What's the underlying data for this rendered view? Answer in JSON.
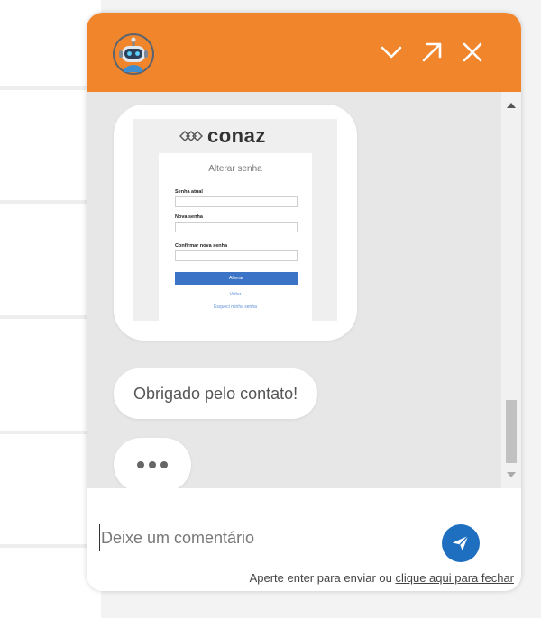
{
  "colors": {
    "header": "#f0852b",
    "send_button": "#1e6fc0",
    "chat_background": "#e7e7e7"
  },
  "header": {
    "avatar_icon": "robot-avatar-icon",
    "minimize_icon": "chevron-down-icon",
    "expand_icon": "arrow-up-right-icon",
    "close_icon": "close-icon"
  },
  "messages": {
    "image_preview": {
      "logo_text": "conaz",
      "form_title": "Alterar senha",
      "fields": [
        "Senha atual",
        "Nova senha",
        "Confirmar nova senha"
      ],
      "button_label": "Alterar",
      "link_back": "Voltar",
      "link_forgot": "Esqueci minha senha"
    },
    "text_message": "Obrigado pelo contato!",
    "typing_indicator": "typing-dots-icon"
  },
  "composer": {
    "placeholder": "Deixe um comentário",
    "send_icon": "paper-plane-icon",
    "hint_prefix": "Aperte enter para enviar ou ",
    "hint_link": "clique aqui para fechar"
  }
}
